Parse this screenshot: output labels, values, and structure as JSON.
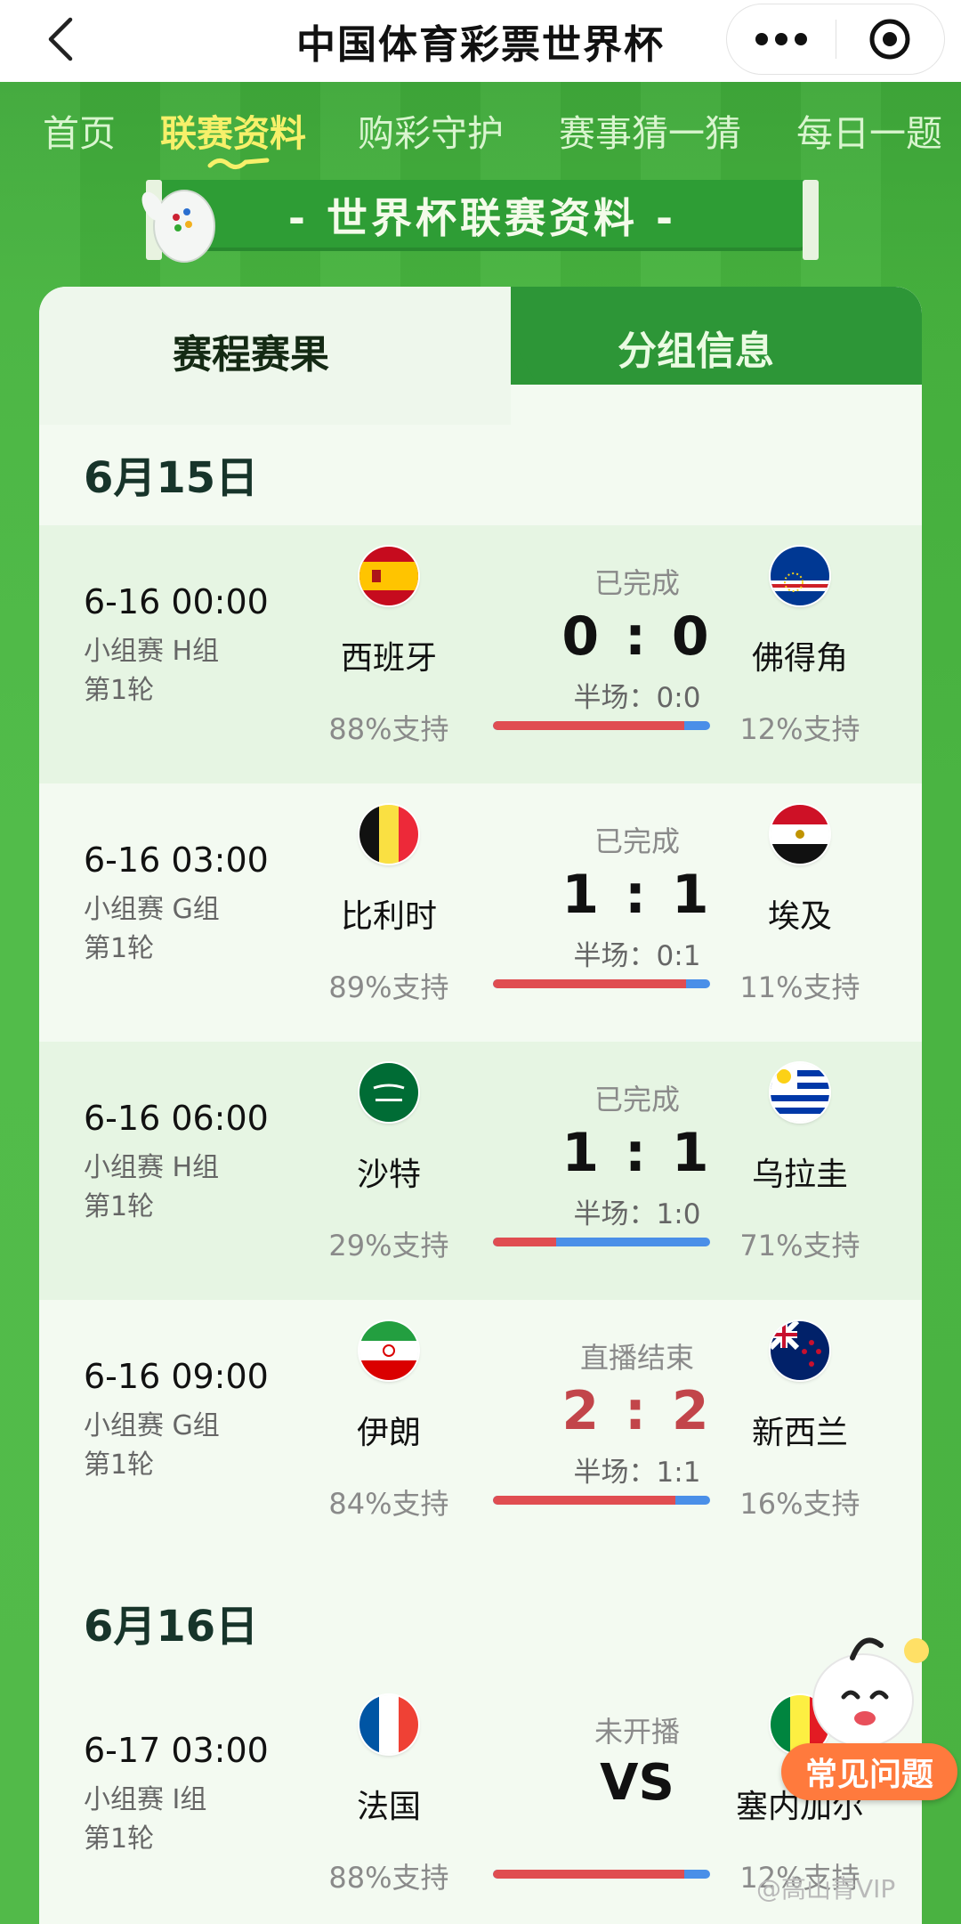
{
  "app": {
    "title": "中国体育彩票世界杯",
    "more_icon": "more-horizontal-icon",
    "target_icon": "target-circle-icon"
  },
  "nav": {
    "items": [
      {
        "label": "首页"
      },
      {
        "label": "联赛资料"
      },
      {
        "label": "购彩守护"
      },
      {
        "label": "赛事猜一猜"
      },
      {
        "label": "每日一题"
      }
    ],
    "active_index": 1
  },
  "banner": {
    "text": "- 世界杯联赛资料 -"
  },
  "tabs": [
    {
      "label": "赛程赛果"
    },
    {
      "label": "分组信息"
    }
  ],
  "days": [
    {
      "date": "6月15日",
      "matches": [
        {
          "time": "6-16 00:00",
          "stage": "小组赛 H组",
          "round": "第1轮",
          "home": "西班牙",
          "away": "佛得角",
          "home_flag": "spain-flag",
          "away_flag": "cape-verde-flag",
          "status": "已完成",
          "score": "0 : 0",
          "half": "半场：0:0",
          "home_support": "88%支持",
          "away_support": "12%支持",
          "home_pct": 88
        },
        {
          "time": "6-16 03:00",
          "stage": "小组赛 G组",
          "round": "第1轮",
          "home": "比利时",
          "away": "埃及",
          "home_flag": "belgium-flag",
          "away_flag": "egypt-flag",
          "status": "已完成",
          "score": "1 : 1",
          "half": "半场：0:1",
          "home_support": "89%支持",
          "away_support": "11%支持",
          "home_pct": 89
        },
        {
          "time": "6-16 06:00",
          "stage": "小组赛 H组",
          "round": "第1轮",
          "home": "沙特",
          "away": "乌拉圭",
          "home_flag": "saudi-arabia-flag",
          "away_flag": "uruguay-flag",
          "status": "已完成",
          "score": "1 : 1",
          "half": "半场：1:0",
          "home_support": "29%支持",
          "away_support": "71%支持",
          "home_pct": 29
        },
        {
          "time": "6-16 09:00",
          "stage": "小组赛 G组",
          "round": "第1轮",
          "home": "伊朗",
          "away": "新西兰",
          "home_flag": "iran-flag",
          "away_flag": "new-zealand-flag",
          "status": "直播结束",
          "score": "2 : 2",
          "half": "半场：1:1",
          "home_support": "84%支持",
          "away_support": "16%支持",
          "home_pct": 84
        }
      ]
    },
    {
      "date": "6月16日",
      "matches": [
        {
          "time": "6-17 03:00",
          "stage": "小组赛 I组",
          "round": "第1轮",
          "home": "法国",
          "away": "塞内加尔",
          "home_flag": "france-flag",
          "away_flag": "senegal-flag",
          "status": "未开播",
          "vs": "VS",
          "home_support": "88%支持",
          "away_support": "12%支持",
          "home_pct": 88
        }
      ]
    }
  ],
  "help": {
    "label": "常见问题"
  },
  "watermark": "@高山青VIP",
  "colors": {
    "home_bar": "#e04d51",
    "away_bar": "#4a8fe8",
    "live_score": "#c2454a",
    "nav_active": "#f7f06a"
  }
}
